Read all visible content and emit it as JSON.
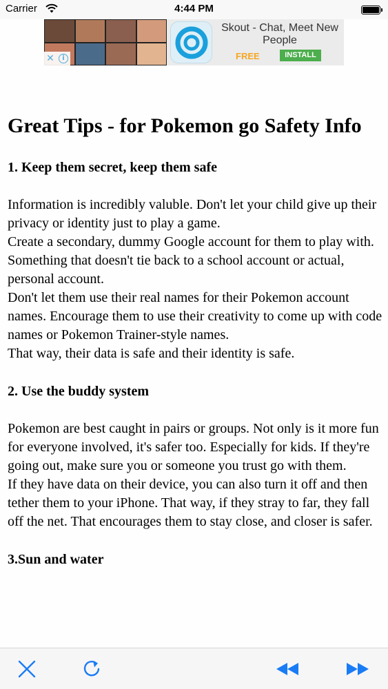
{
  "status_bar": {
    "carrier": "Carrier",
    "time": "4:44 PM"
  },
  "ad": {
    "title": "Skout - Chat, Meet New People",
    "free_label": "FREE",
    "install_label": "INSTALL",
    "accent_color": "#4fb0e0"
  },
  "article": {
    "title": "Great Tips - for Pokemon go Safety Info",
    "sections": [
      {
        "heading": "1. Keep them secret, keep them safe",
        "paragraphs": [
          "Information is incredibly valuble. Don't let your child give up their privacy or identity just to play a game.",
          "Create a secondary, dummy Google account for them to play with. Something that doesn't tie back to a school account or actual, personal account.",
          "Don't let them use their real names for their Pokemon account names. Encourage them to use their creativity to come up with code names or Pokemon Trainer-style names.",
          "That way, their data is safe and their identity is safe."
        ]
      },
      {
        "heading": "2. Use the buddy system",
        "paragraphs": [
          "Pokemon are best caught in pairs or groups. Not only is it more fun for everyone involved, it's safer too. Especially for kids. If they're going out, make sure you or someone you trust go with them.",
          "If they have data on their device, you can also turn it off and then tether them to your iPhone. That way, if they stray to far, they fall off the net. That encourages them to stay close, and closer is safer."
        ]
      },
      {
        "heading": "3.Sun and water",
        "paragraphs": []
      }
    ]
  },
  "toolbar": {
    "icons": [
      "close-icon",
      "refresh-icon",
      "rewind-icon",
      "fast-forward-icon"
    ],
    "tint_color": "#1a7cf5"
  }
}
